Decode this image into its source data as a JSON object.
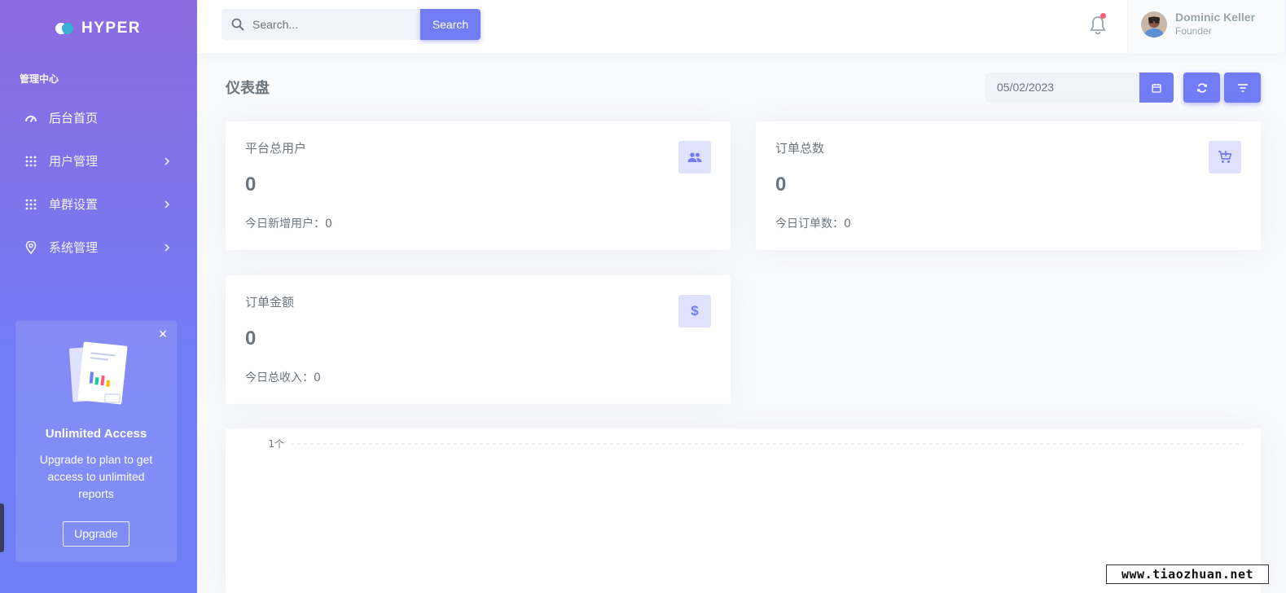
{
  "brand": {
    "name": "HYPER"
  },
  "sidebar": {
    "section_title": "管理中心",
    "items": [
      {
        "label": "后台首页",
        "icon": "gauge-icon",
        "has_children": false
      },
      {
        "label": "用户管理",
        "icon": "grid-dots-icon",
        "has_children": true
      },
      {
        "label": "单群设置",
        "icon": "grid-dots-icon",
        "has_children": true
      },
      {
        "label": "系统管理",
        "icon": "map-pin-icon",
        "has_children": true
      }
    ],
    "promo": {
      "title": "Unlimited Access",
      "text": "Upgrade to plan to get access to unlimited reports",
      "button": "Upgrade"
    }
  },
  "topbar": {
    "search": {
      "placeholder": "Search...",
      "button": "Search"
    },
    "notification_icon": "bell-icon",
    "user": {
      "name": "Dominic Keller",
      "role": "Founder"
    }
  },
  "page": {
    "title": "仪表盘",
    "date": "05/02/2023"
  },
  "stats": [
    {
      "label": "平台总用户",
      "value": "0",
      "sub": "今日新增用户：0",
      "icon": "users-icon"
    },
    {
      "label": "订单总数",
      "value": "0",
      "sub": "今日订单数：0",
      "icon": "cart-icon"
    },
    {
      "label": "订单金额",
      "value": "0",
      "sub": "今日总收入：0",
      "icon": "dollar-icon",
      "icon_text": "$"
    }
  ],
  "chart_data": {
    "type": "line",
    "y_tick_labels": [
      "1个"
    ],
    "series": [],
    "grid": true
  },
  "colors": {
    "primary": "#727cf5",
    "sidebar_top": "#8d6be0",
    "sidebar_bottom": "#6f7ff5",
    "badge": "#fa5c7c"
  },
  "watermark": "www.tiaozhuan.net"
}
